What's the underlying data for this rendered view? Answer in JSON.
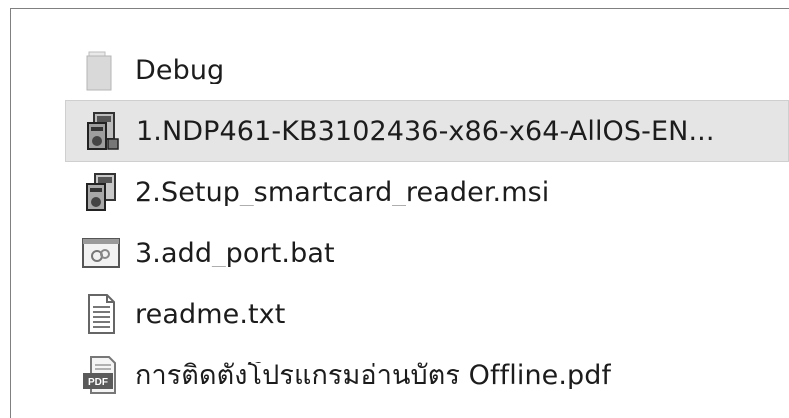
{
  "files": [
    {
      "name": "Debug",
      "icon": "folder-icon",
      "selected": false
    },
    {
      "name": "1.NDP461-KB3102436-x86-x64-AllOS-EN...",
      "icon": "installer-exe-icon",
      "selected": true
    },
    {
      "name": "2.Setup_smartcard_reader.msi",
      "icon": "installer-msi-icon",
      "selected": false
    },
    {
      "name": "3.add_port.bat",
      "icon": "batch-file-icon",
      "selected": false
    },
    {
      "name": "readme.txt",
      "icon": "text-file-icon",
      "selected": false
    },
    {
      "name": "การติดตั้งโปรแกรมอ่านบัตร Offline.pdf",
      "icon": "pdf-file-icon",
      "selected": false
    }
  ],
  "colors": {
    "selection": "#e5e5e5",
    "text": "#1c1c1c",
    "border": "#808080"
  }
}
